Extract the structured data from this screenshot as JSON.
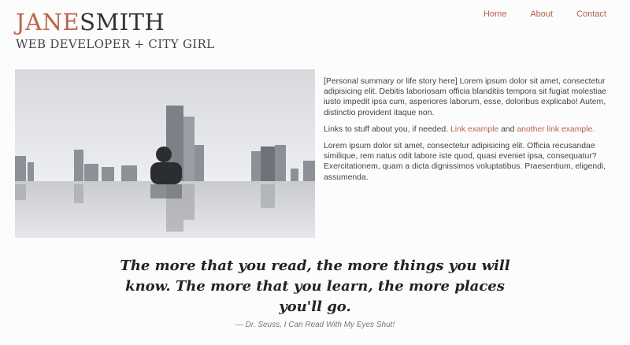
{
  "header": {
    "name_first": "JANE",
    "name_last": "SMITH",
    "tagline": "WEB DEVELOPER + CITY GIRL"
  },
  "nav": {
    "items": [
      {
        "label": "Home"
      },
      {
        "label": "About"
      },
      {
        "label": "Contact"
      }
    ]
  },
  "colors": {
    "accent": "#c0634a",
    "text": "#333333",
    "background": "#fdfcfc"
  },
  "bio": {
    "p1": "[Personal summary or life story here] Lorem ipsum dolor sit amet, consectetur adipisicing elit. Debitis laboriosam officia blanditiis tempora sit fugiat molestiae iusto impedit ipsa cum, asperiores laborum, esse, doloribus explicabo! Autem, distinctio provident itaque non.",
    "p2_before": "Links to stuff about you, if needed. ",
    "link1": "Link example",
    "p2_between": " and ",
    "link2": "another link example.",
    "p3": "Lorem ipsum dolor sit amet, consectetur adipisicing elit. Officia recusandae similique, rem natus odit labore iste quod, quasi eveniet ipsa, consequatur? Exercitationem, quam a dicta dignissimos voluptatibus. Praesentium, eligendi, assumenda."
  },
  "quote": {
    "text": "The more that you read, the more things you will know. The more that you learn, the more places you'll go.",
    "attribution": "— Dr. Seuss, I Can Read With My Eyes Shut!"
  }
}
